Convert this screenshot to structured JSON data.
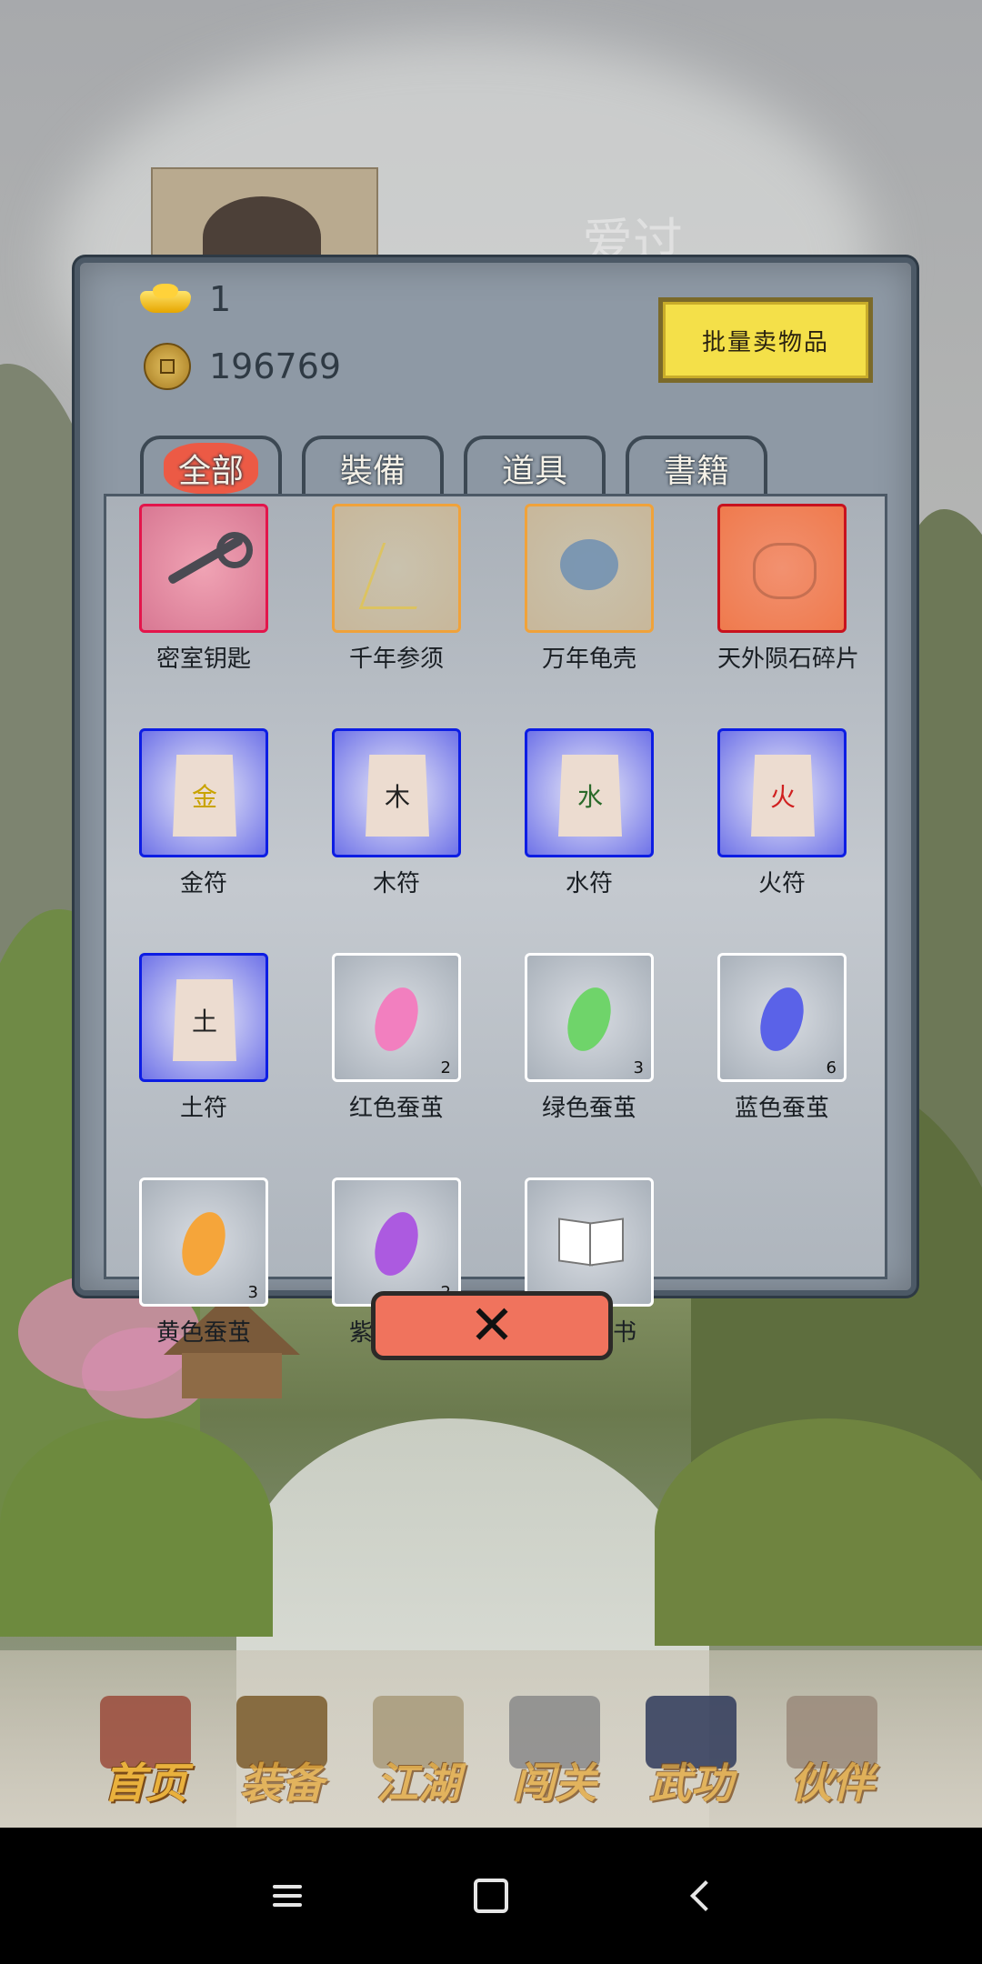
{
  "background": {
    "ghost_title": "爱过"
  },
  "currency": {
    "gold": "1",
    "coins": "196769"
  },
  "batch_sell_label": "批量卖物品",
  "tabs": [
    {
      "label": "全部",
      "active": true
    },
    {
      "label": "裝備",
      "active": false
    },
    {
      "label": "道具",
      "active": false
    },
    {
      "label": "書籍",
      "active": false
    }
  ],
  "items": [
    {
      "name": "密室钥匙",
      "rarity": "red",
      "icon": "key-icon",
      "count": ""
    },
    {
      "name": "千年参须",
      "rarity": "orange",
      "icon": "ginseng-icon",
      "count": ""
    },
    {
      "name": "万年龟壳",
      "rarity": "orange",
      "icon": "turtle-shell-icon",
      "count": ""
    },
    {
      "name": "天外陨石碎片",
      "rarity": "fire",
      "icon": "meteorite-icon",
      "count": ""
    },
    {
      "name": "金符",
      "rarity": "blue",
      "icon": "talisman-icon",
      "glyph": "金",
      "glyph_color": "#c9a300",
      "count": ""
    },
    {
      "name": "木符",
      "rarity": "blue",
      "icon": "talisman-icon",
      "glyph": "木",
      "glyph_color": "#222222",
      "count": ""
    },
    {
      "name": "水符",
      "rarity": "blue",
      "icon": "talisman-icon",
      "glyph": "水",
      "glyph_color": "#2a6a2a",
      "count": ""
    },
    {
      "name": "火符",
      "rarity": "blue",
      "icon": "talisman-icon",
      "glyph": "火",
      "glyph_color": "#d02020",
      "count": ""
    },
    {
      "name": "土符",
      "rarity": "blue",
      "icon": "talisman-icon",
      "glyph": "土",
      "glyph_color": "#222222",
      "count": ""
    },
    {
      "name": "红色蚕茧",
      "rarity": "white",
      "icon": "cocoon-icon",
      "color": "#f27fbf",
      "count": "2"
    },
    {
      "name": "绿色蚕茧",
      "rarity": "white",
      "icon": "cocoon-icon",
      "color": "#6fd46a",
      "count": "3"
    },
    {
      "name": "蓝色蚕茧",
      "rarity": "white",
      "icon": "cocoon-icon",
      "color": "#5a62e8",
      "count": "6"
    },
    {
      "name": "黄色蚕茧",
      "rarity": "white",
      "icon": "cocoon-icon",
      "color": "#f5a53a",
      "count": "3"
    },
    {
      "name": "紫色蚕茧",
      "rarity": "white",
      "icon": "cocoon-icon",
      "color": "#ac5ae0",
      "count": "2"
    },
    {
      "name": "无字白书",
      "rarity": "white",
      "icon": "book-icon",
      "count": ""
    }
  ],
  "close_label": "✕",
  "bottom_nav": [
    {
      "label": "首页",
      "icon": "house-icon",
      "color": "#9a4a3a"
    },
    {
      "label": "装备",
      "icon": "armor-icon",
      "color": "#7a5a2a"
    },
    {
      "label": "江湖",
      "icon": "scroll-icon",
      "color": "#a89a7a"
    },
    {
      "label": "闯关",
      "icon": "swords-icon",
      "color": "#8a8a8a"
    },
    {
      "label": "武功",
      "icon": "martial-book-icon",
      "color": "#2f3a5a"
    },
    {
      "label": "伙伴",
      "icon": "companions-icon",
      "color": "#9a8a7a"
    }
  ]
}
